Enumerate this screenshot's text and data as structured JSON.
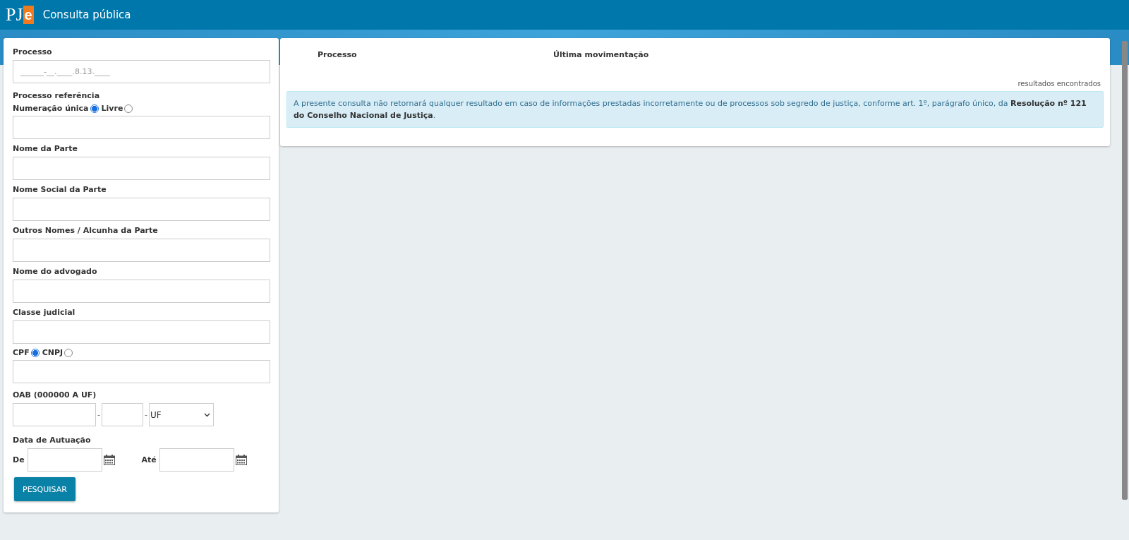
{
  "header": {
    "logo_letters": "PJ",
    "logo_accent": "e",
    "title": "Consulta pública"
  },
  "form": {
    "fields": [
      {
        "kind": "text",
        "label": "Processo",
        "placeholder": "______-__.____.8.13.____"
      },
      {
        "kind": "section",
        "label": "Processo referência"
      },
      {
        "kind": "radio",
        "options": [
          {
            "label": "Numeração única",
            "selected": true
          },
          {
            "label": "Livre",
            "selected": false
          }
        ]
      },
      {
        "kind": "text",
        "label": "Nome da Parte"
      },
      {
        "kind": "text",
        "label": "Nome Social da Parte"
      },
      {
        "kind": "text",
        "label": "Outros Nomes / Alcunha da Parte"
      },
      {
        "kind": "text",
        "label": "Nome do advogado"
      },
      {
        "kind": "text",
        "label": "Classe judicial"
      },
      {
        "kind": "radio",
        "options": [
          {
            "label": "CPF",
            "selected": true
          },
          {
            "label": "CNPJ",
            "selected": false
          }
        ]
      },
      {
        "kind": "oab",
        "label": "OAB (000000 A UF)",
        "separator_1": "-",
        "separator_2": "-",
        "select_value": "UF"
      },
      {
        "kind": "dates",
        "label": "Data de Autuação",
        "from": "De",
        "to": "Até"
      }
    ],
    "submit": "PESQUISAR"
  },
  "results": {
    "columns": [
      "Processo",
      "Última movimentação"
    ],
    "count_label": "resultados encontrados",
    "notice": "A presente consulta não retornará qualquer resultado em caso de informações prestadas incorretamente ou de processos sob segredo de justiça, conforme art. 1º, parágrafo único, da **Resolução nº 121 do Conselho Nacional de Justiça**."
  }
}
